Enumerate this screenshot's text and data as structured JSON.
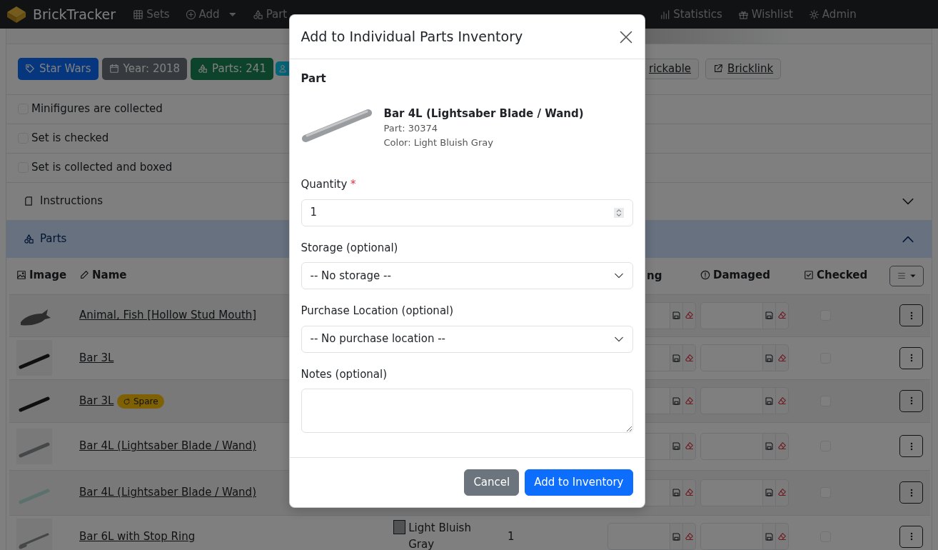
{
  "navbar": {
    "brand": "BrickTracker",
    "items": [
      {
        "label": "Sets",
        "dropdown": false
      },
      {
        "label": "Add",
        "dropdown": true
      },
      {
        "label": "Part",
        "dropdown": false
      },
      {
        "label": "Statistics",
        "dropdown": false
      },
      {
        "label": "Wishlist",
        "dropdown": false
      },
      {
        "label": "Admin",
        "dropdown": false
      }
    ]
  },
  "set": {
    "badges": [
      {
        "kind": "text",
        "label": "Star Wars"
      },
      {
        "kind": "text",
        "label": "Year: 2018"
      },
      {
        "kind": "text",
        "label": "Parts: 241"
      },
      {
        "kind": "icon"
      }
    ],
    "links": [
      {
        "label": "rickable"
      },
      {
        "label": "Bricklink"
      }
    ],
    "checks": [
      {
        "label": "Minifigures are collected",
        "checked": false
      },
      {
        "label": "Set is checked",
        "checked": false
      },
      {
        "label": "Set is collected and boxed",
        "checked": false
      }
    ],
    "sections": [
      {
        "title": "Instructions",
        "expanded": false
      },
      {
        "title": "Parts",
        "expanded": true
      }
    ]
  },
  "table": {
    "columns": [
      {
        "label": "Image"
      },
      {
        "label": "Name"
      },
      {
        "label": "ng"
      },
      {
        "label": "Damaged"
      },
      {
        "label": "Checked"
      }
    ],
    "rows": [
      {
        "name": "Animal, Fish [Hollow Stud Mouth]",
        "image": {
          "kind": "fish"
        },
        "checked": false
      },
      {
        "name": "Bar 3L",
        "image": {
          "kind": "blackbar"
        },
        "checked": false
      },
      {
        "name": "Bar 3L",
        "badge": "Spare",
        "image": {
          "kind": "blackbar"
        },
        "checked": false
      },
      {
        "name": "Bar 4L (Lightsaber Blade / Wand)",
        "image": {
          "kind": "graybar"
        },
        "checked": false
      },
      {
        "name": "Bar 4L (Lightsaber Blade / Wand)",
        "image": {
          "kind": "clearbar"
        },
        "checked": false
      },
      {
        "name": "Bar 6L with Stop Ring",
        "image": {
          "kind": "longbar"
        },
        "color_name": "Light Bluish Gray",
        "quantity": "1",
        "checked": false
      }
    ]
  },
  "modal": {
    "title": "Add to Individual Parts Inventory",
    "section_label": "Part",
    "part": {
      "name": "Bar 4L (Lightsaber Blade / Wand)",
      "number": "Part: 30374",
      "color_text": "Color: Light Bluish Gray"
    },
    "fields": [
      {
        "kind": "number",
        "label": "Quantity",
        "required_mark": "*",
        "value": "1"
      },
      {
        "kind": "select",
        "label": "Storage (optional)",
        "value": "-- No storage --"
      },
      {
        "kind": "select",
        "label": "Purchase Location (optional)",
        "value": "-- No purchase location --"
      },
      {
        "kind": "textarea",
        "label": "Notes (optional)"
      }
    ],
    "buttons": [
      {
        "label": "Cancel",
        "kind": "secondary"
      },
      {
        "label": "Add to Inventory",
        "kind": "primary"
      }
    ]
  }
}
